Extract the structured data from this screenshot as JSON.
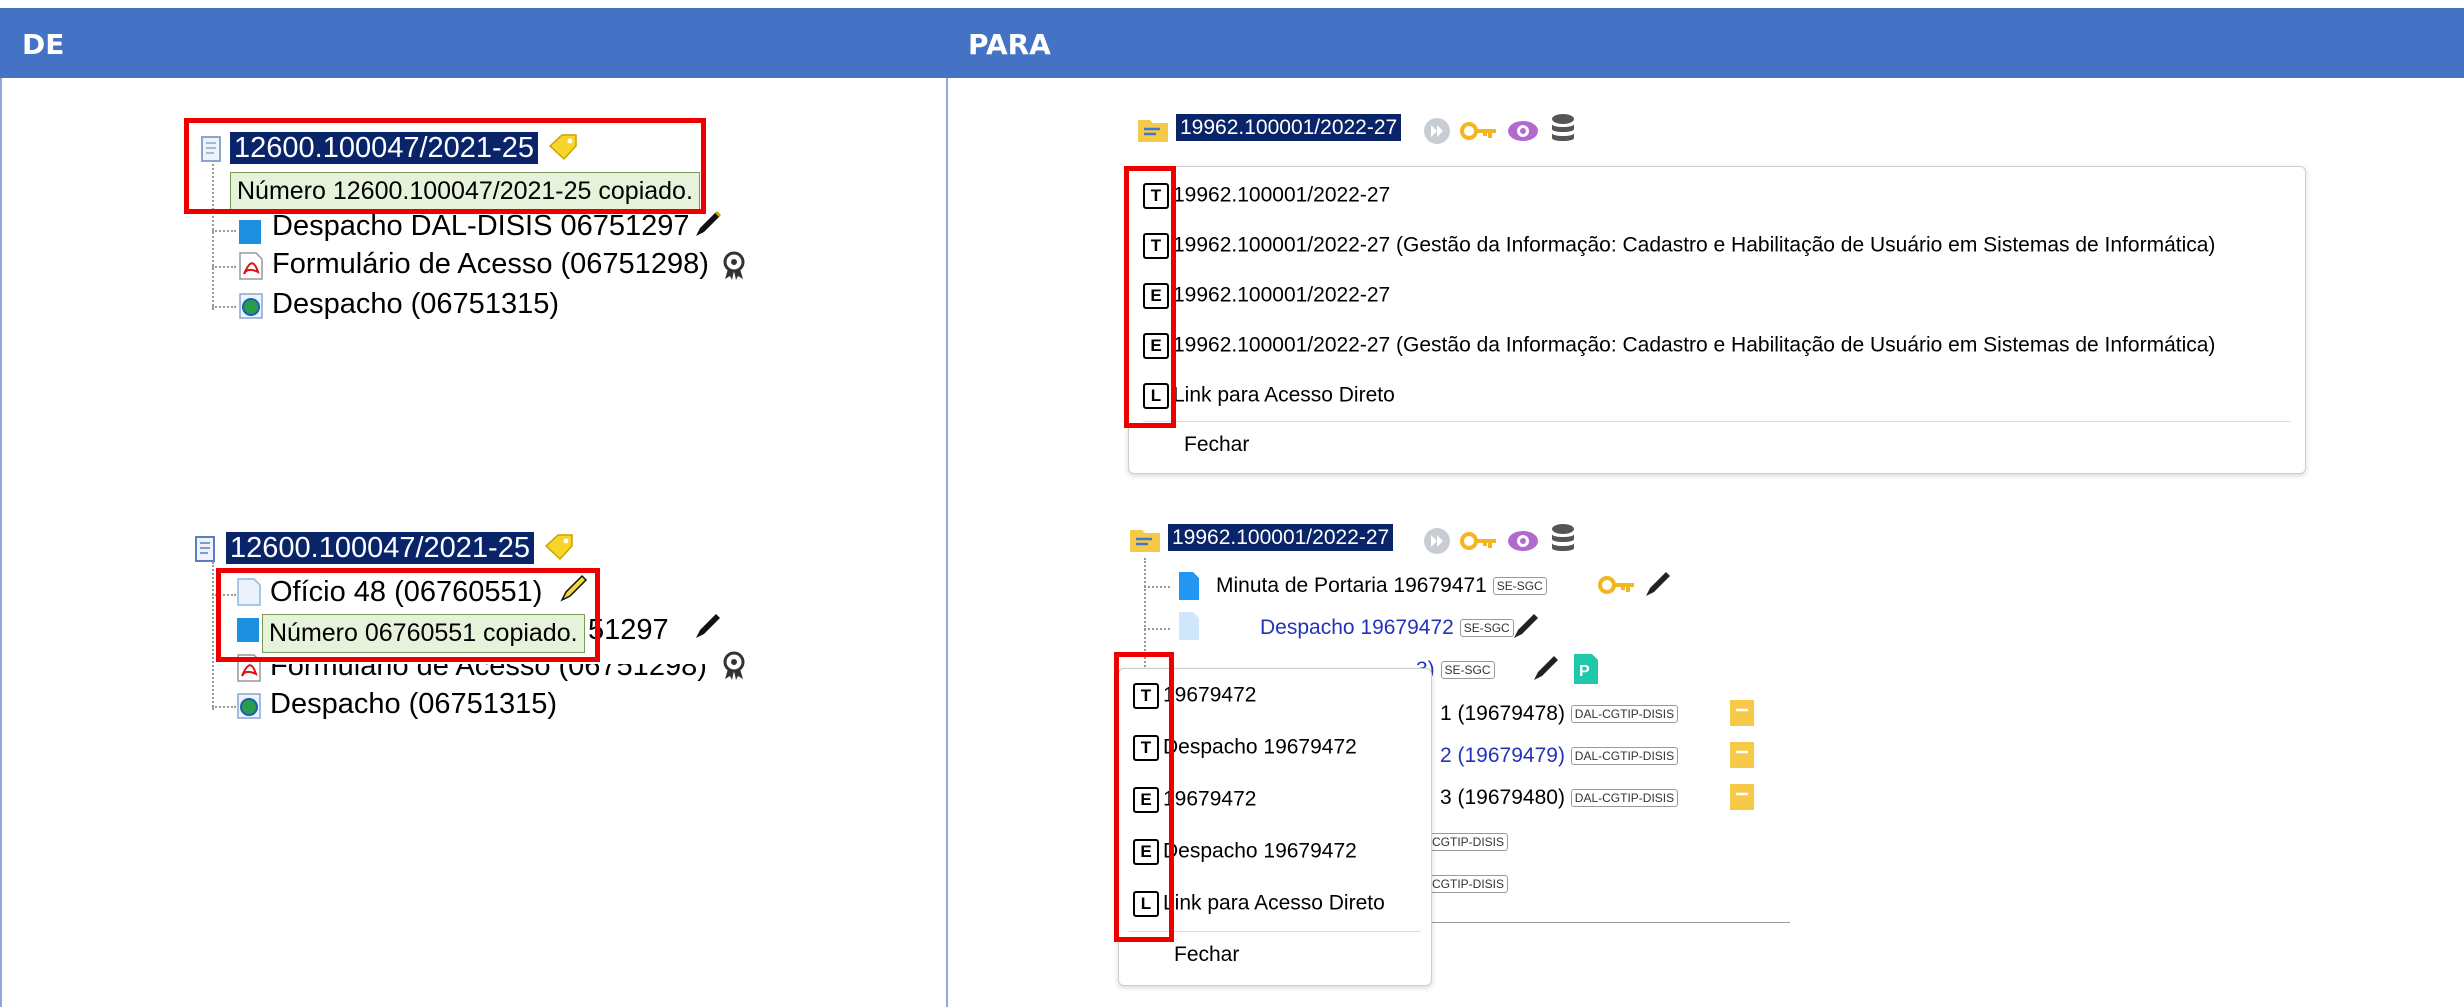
{
  "header": {
    "de": "DE",
    "para": "PARA"
  },
  "de_top": {
    "process": "12600.100047/2021-25",
    "tooltip": "Número 12600.100047/2021-25 copiado.",
    "doc1": "Despacho DAL-DISIS 06751297",
    "doc2": "Formulário de Acesso (06751298)",
    "doc3": "Despacho (06751315)"
  },
  "de_bottom": {
    "process": "12600.100047/2021-25",
    "doc0": "Ofício 48 (06760551)",
    "tooltip": "Número 06760551 copiado.",
    "doc1_partial": "51297",
    "doc2": "Formulário de Acesso (06751298)",
    "doc3": "Despacho (06751315)"
  },
  "para_top": {
    "process": "19962.100001/2022-27",
    "menu": [
      {
        "key": "T",
        "label": "19962.100001/2022-27"
      },
      {
        "key": "T",
        "label": "19962.100001/2022-27 (Gestão da Informação: Cadastro e Habilitação de Usuário em Sistemas de Informática)"
      },
      {
        "key": "E",
        "label": "19962.100001/2022-27"
      },
      {
        "key": "E",
        "label": "19962.100001/2022-27 (Gestão da Informação: Cadastro e Habilitação de Usuário em Sistemas de Informática)"
      },
      {
        "key": "L",
        "label": "Link para Acesso Direto"
      }
    ],
    "close": "Fechar"
  },
  "para_bottom": {
    "process": "19962.100001/2022-27",
    "doc1": "Minuta de Portaria 19679471",
    "doc1_tag": "SE-SGC",
    "doc2": "Despacho 19679472",
    "doc2_tag": "SE-SGC",
    "doc3_partial": "3)",
    "doc3_tag": "SE-SGC",
    "doc4_partial": "1 (19679478)",
    "doc5_partial": "2 (19679479)",
    "doc6_partial": "3 (19679480)",
    "tag_dal": "DAL-CGTIP-DISIS",
    "tag_dal_partial": "CGTIP-DISIS",
    "menu": [
      {
        "key": "T",
        "label": "19679472"
      },
      {
        "key": "T",
        "label": "Despacho 19679472"
      },
      {
        "key": "E",
        "label": "19679472"
      },
      {
        "key": "E",
        "label": "Despacho 19679472"
      },
      {
        "key": "L",
        "label": "Link para Acesso Direto"
      }
    ],
    "close": "Fechar"
  },
  "colors": {
    "header": "#4472c4",
    "selection": "#0a246a",
    "highlight_box": "#ee0000",
    "tooltip_bg": "#e6f2d9"
  }
}
